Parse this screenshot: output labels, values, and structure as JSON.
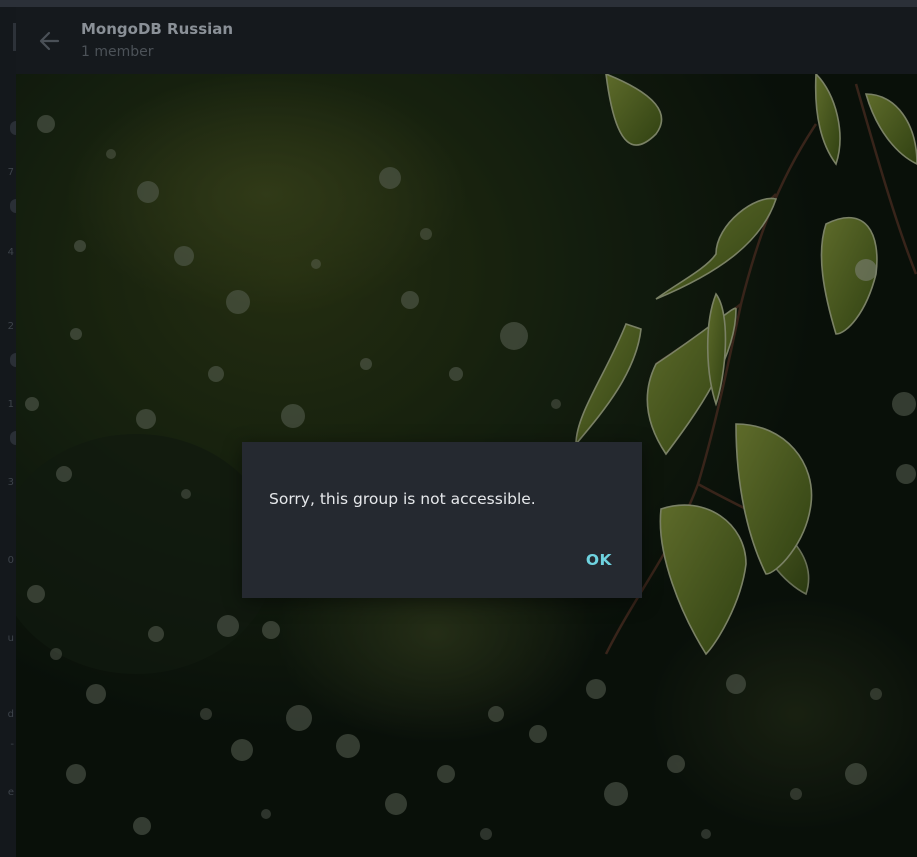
{
  "header": {
    "title": "MongoDB Russian",
    "subtitle": "1 member"
  },
  "dialog": {
    "message": "Sorry, this group is not accessible.",
    "ok_label": "OK"
  },
  "sidebar": {
    "fragments": [
      "7",
      "4",
      "2",
      "1",
      "3",
      "0",
      "u",
      "d",
      "-",
      "e"
    ]
  },
  "colors": {
    "accent": "#6fd3e0",
    "dialog_bg": "#252930",
    "header_bg": "#15191d"
  }
}
